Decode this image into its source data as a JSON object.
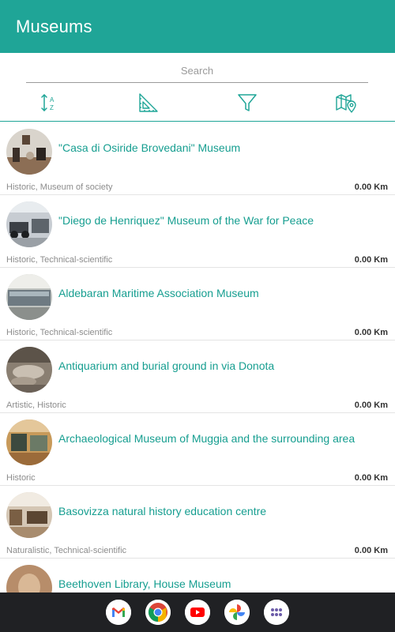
{
  "appbar": {
    "title": "Museums"
  },
  "search": {
    "placeholder": "Search",
    "value": ""
  },
  "toolbar": {
    "icons": [
      "sort-az-icon",
      "ruler-distance-icon",
      "filter-icon",
      "map-pin-icon"
    ]
  },
  "museums": [
    {
      "name": "\"Casa di Osiride Brovedani\" Museum",
      "category": "Historic, Museum of society",
      "distance": "0.00 Km"
    },
    {
      "name": "\"Diego de Henriquez\" Museum of the War for Peace",
      "category": "Historic, Technical-scientific",
      "distance": "0.00 Km"
    },
    {
      "name": "Aldebaran Maritime Association Museum",
      "category": "Historic, Technical-scientific",
      "distance": "0.00 Km"
    },
    {
      "name": "Antiquarium and burial ground in via Donota",
      "category": "Artistic, Historic",
      "distance": "0.00 Km"
    },
    {
      "name": "Archaeological Museum of Muggia and the surrounding area",
      "category": "Historic",
      "distance": "0.00 Km"
    },
    {
      "name": "Basovizza natural history education centre",
      "category": "Naturalistic, Technical-scientific",
      "distance": "0.00 Km"
    },
    {
      "name": "Beethoven Library, House Museum",
      "category": "",
      "distance": ""
    }
  ],
  "dock": {
    "apps": [
      "gmail-icon",
      "chrome-icon",
      "youtube-icon",
      "photos-icon",
      "app-drawer-icon"
    ]
  },
  "colors": {
    "accent": "#1fa597",
    "link": "#169e90",
    "navbar": "#202124"
  }
}
